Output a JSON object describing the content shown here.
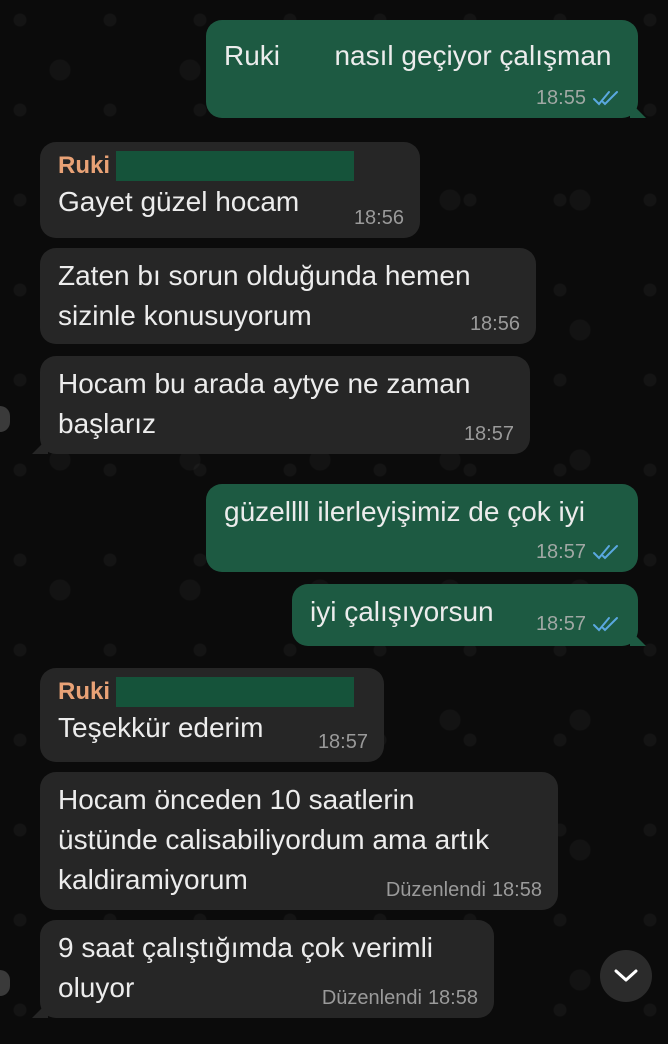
{
  "messages": [
    {
      "id": "m1",
      "dir": "out",
      "text": "Ruki       nasıl geçiyor çalışman",
      "time": "18:55",
      "read": true
    },
    {
      "id": "m2",
      "dir": "in",
      "sender": "Ruki",
      "text": "Gayet güzel hocam",
      "time": "18:56"
    },
    {
      "id": "m3",
      "dir": "in",
      "text": "Zaten bı sorun olduğunda hemen sizinle konusuyorum",
      "line1": "Zaten bı sorun olduğunda hemen",
      "line2": "sizinle konusuyorum",
      "time": "18:56"
    },
    {
      "id": "m4",
      "dir": "in",
      "line1": "Hocam bu arada aytye ne zaman",
      "line2": "başlarız",
      "time": "18:57"
    },
    {
      "id": "m5",
      "dir": "out",
      "text": "güzellll ilerleyişimiz de çok iyi",
      "time": "18:57",
      "read": true
    },
    {
      "id": "m6",
      "dir": "out",
      "text": "iyi çalışıyorsun",
      "time": "18:57",
      "read": true
    },
    {
      "id": "m7",
      "dir": "in",
      "sender": "Ruki",
      "text": "Teşekkür ederim",
      "time": "18:57"
    },
    {
      "id": "m8",
      "dir": "in",
      "line1": "Hocam önceden 10 saatlerin",
      "line2": "üstünde calisabiliyordum ama artık",
      "line3": "kaldiramiyorum",
      "edited": "Düzenlendi",
      "time": "18:58"
    },
    {
      "id": "m9",
      "dir": "in",
      "line1": "9 saat çalıştığımda çok verimli",
      "line2": "oluyor",
      "edited": "Düzenlendi",
      "time": "18:58"
    }
  ],
  "colors": {
    "outgoing": "#1d5a42",
    "incoming": "#262626",
    "sender": "#e9a276",
    "ticks": "#5aa8e0",
    "background": "#0b0b0b"
  },
  "icons": {
    "read_receipt": "double-check-icon",
    "scroll_down": "chevron-down-icon"
  }
}
